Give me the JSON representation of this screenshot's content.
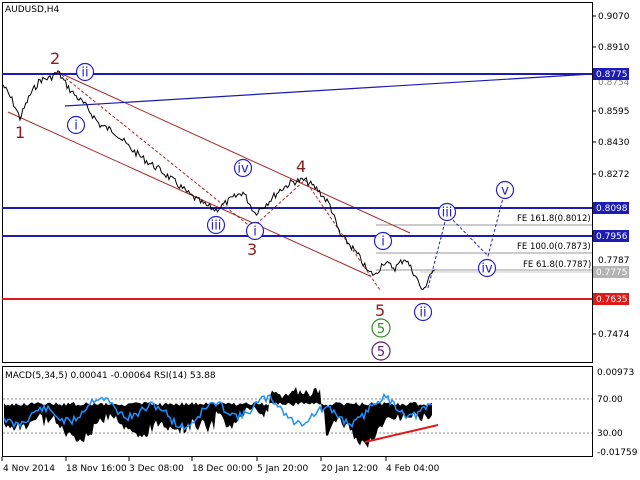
{
  "chart": {
    "title": "AUDUSD,H4",
    "indicator_label": "MACD(5,34,5) 0.00041 -0.00064 RSI(14) 53.88",
    "price_ticks": [
      "0.9070",
      "0.8910",
      "0.8595",
      "0.8430",
      "0.8272",
      "0.7787",
      "0.7474"
    ],
    "price_tags": [
      {
        "label": "0.8775",
        "color": "#1c1cb3"
      },
      {
        "label": "0.8098",
        "color": "#1c1cb3"
      },
      {
        "label": "0.7956",
        "color": "#1c1cb3"
      },
      {
        "label": "0.7635",
        "color": "#e01818"
      },
      {
        "label": "0.7775",
        "color": "#b4b4b4"
      }
    ],
    "faded_ticks": [
      "0.8754"
    ],
    "fib_notes": [
      "FE 161.8(0.8012)",
      "FE 100.0(0.7873)",
      "FE 61.8(0.7787)"
    ],
    "wave_brown": [
      "1",
      "2",
      "3",
      "4",
      "5"
    ],
    "wave_circled": [
      "ii",
      "i",
      "iv",
      "iii",
      "i",
      "iii",
      "iv",
      "v",
      "ii",
      "5",
      "5"
    ],
    "indicator_ticks": [
      "0.00973",
      "70.00",
      "30.00",
      "-0.01759"
    ],
    "time_labels": [
      "4 Nov 2014",
      "18 Nov 16:00",
      "3 Dec 08:00",
      "18 Dec 00:00",
      "5 Jan 20:00",
      "20 Jan 12:00",
      "4 Feb 04:00"
    ],
    "colors": {
      "level": "#1c1cb3",
      "support": "#e01818",
      "channel": "#a52a2a",
      "rsi": "#1e90ff",
      "label_blue": "#2222cc",
      "label_brown": "#8b1a1a",
      "label_green": "#2e8b22",
      "label_purple": "#5a1a7a"
    }
  }
}
